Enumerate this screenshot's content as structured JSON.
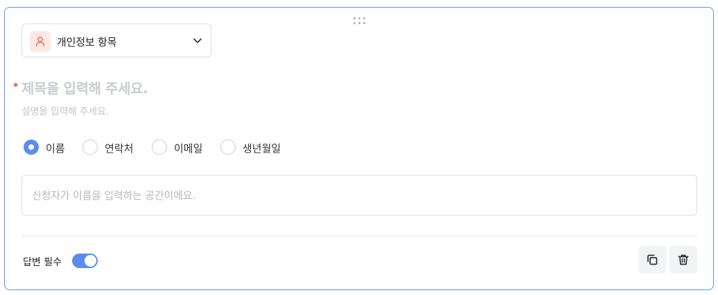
{
  "question_type": {
    "label": "개인정보 항목",
    "icon": "person-icon",
    "accent_color": "#f06b5b"
  },
  "question": {
    "required_mark": "*",
    "title_placeholder": "제목을 입력해 주세요.",
    "description_placeholder": "설명을 입력해 주세요."
  },
  "options": [
    {
      "label": "이름",
      "checked": true
    },
    {
      "label": "연락처",
      "checked": false
    },
    {
      "label": "이메일",
      "checked": false
    },
    {
      "label": "생년월일",
      "checked": false
    }
  ],
  "answer": {
    "placeholder": "신청자가 이름을 입력하는 공간이에요."
  },
  "footer": {
    "required_label": "답변 필수",
    "required_on": true,
    "copy_icon": "copy-icon",
    "delete_icon": "trash-icon"
  },
  "colors": {
    "primary": "#5b8def",
    "required_star": "#e5483b"
  }
}
